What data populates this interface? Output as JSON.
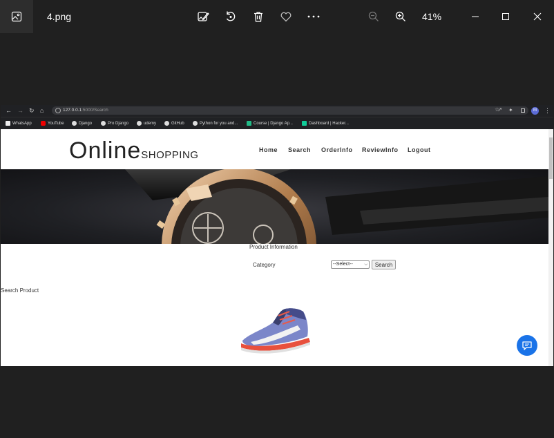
{
  "viewer": {
    "filename": "4.png",
    "zoom": "41%",
    "icons": [
      "gallery-icon",
      "edit-image-icon",
      "rotate-icon",
      "delete-icon",
      "favorite-icon",
      "more-icon",
      "zoom-out-icon",
      "zoom-in-icon",
      "minimize-icon",
      "maximize-icon",
      "close-icon"
    ]
  },
  "browser": {
    "url_host": "127.0.0.1",
    "url_path": ":5000/Search",
    "profile_initial": "M",
    "bookmarks": [
      "WhatsApp",
      "YouTube",
      "Django",
      "Pro Django",
      "udemy",
      "GitHub",
      "Python for you and...",
      "Course | Django Ap...",
      "Dashboard | Hacker..."
    ]
  },
  "site": {
    "logo_main": "Online",
    "logo_sub": "SHOPPING",
    "nav": [
      "Home",
      "Search",
      "OrderInfo",
      "ReviewInfo",
      "Logout"
    ],
    "section_title": "Product Information",
    "category_label": "Category",
    "category_selected": "--Select--",
    "search_button": "Search",
    "search_product_label": "Search Product"
  },
  "colors": {
    "viewer_bg": "#202020",
    "browser_bg": "#202124",
    "chat_fab": "#1a73e8"
  }
}
